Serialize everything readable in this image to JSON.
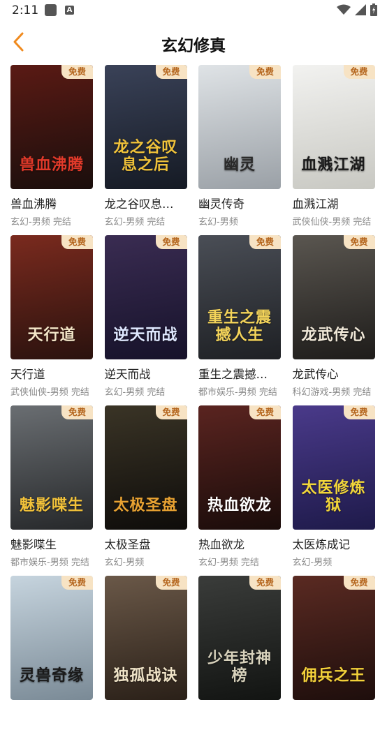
{
  "status_bar": {
    "time": "2:11",
    "a_icon_label": "A"
  },
  "header": {
    "title": "玄幻修真"
  },
  "badge_label": "免费",
  "books": [
    {
      "name": "兽血沸腾",
      "meta": "玄幻-男频 完结",
      "cover_title": "兽血沸腾",
      "bg": "#5a1a14",
      "bg2": "#1a0e0c",
      "fg": "#e23a2a"
    },
    {
      "name": "龙之谷叹息…",
      "meta": "玄幻-男频 完结",
      "cover_title": "龙之谷叹息之后",
      "bg": "#3a4258",
      "bg2": "#151a24",
      "fg": "#f0c23a"
    },
    {
      "name": "幽灵传奇",
      "meta": "玄幻-男频",
      "cover_title": "幽灵",
      "bg": "#dfe3e6",
      "bg2": "#9aa0a6",
      "fg": "#2a2a2a"
    },
    {
      "name": "血溅江湖",
      "meta": "武侠仙侠-男频 完结",
      "cover_title": "血溅江湖",
      "bg": "#f2f2f0",
      "bg2": "#c8c8c2",
      "fg": "#1a1a1a"
    },
    {
      "name": "天行道",
      "meta": "武侠仙侠-男频 完结",
      "cover_title": "天行道",
      "bg": "#7a2a1e",
      "bg2": "#2a120e",
      "fg": "#f4e6c8"
    },
    {
      "name": "逆天而战",
      "meta": "玄幻-男频 完结",
      "cover_title": "逆天而战",
      "bg": "#3a2c52",
      "bg2": "#16122a",
      "fg": "#dfe8ff"
    },
    {
      "name": "重生之震撼…",
      "meta": "都市娱乐-男频 完结",
      "cover_title": "重生之震撼人生",
      "bg": "#4a4e56",
      "bg2": "#1e2024",
      "fg": "#f4d45a"
    },
    {
      "name": "龙武传心",
      "meta": "科幻游戏-男频 完结",
      "cover_title": "龙武传心",
      "bg": "#5a5650",
      "bg2": "#1e1c1a",
      "fg": "#f0e8d8"
    },
    {
      "name": "魅影喋生",
      "meta": "都市娱乐-男频 完结",
      "cover_title": "魅影喋生",
      "bg": "#6a6e72",
      "bg2": "#26282a",
      "fg": "#f2c23a"
    },
    {
      "name": "太极圣盘",
      "meta": "玄幻-男频",
      "cover_title": "太极圣盘",
      "bg": "#3a3426",
      "bg2": "#0e0c0a",
      "fg": "#e8a232"
    },
    {
      "name": "热血欲龙",
      "meta": "玄幻-男频 完结",
      "cover_title": "热血欲龙",
      "bg": "#5a2420",
      "bg2": "#1a0c0a",
      "fg": "#ffffff"
    },
    {
      "name": "太医炼成记",
      "meta": "玄幻-男频",
      "cover_title": "太医修炼狱",
      "bg": "#4a3a8a",
      "bg2": "#1e1a4a",
      "fg": "#f2d63a"
    },
    {
      "name": "",
      "meta": "",
      "cover_title": "灵兽奇缘",
      "bg": "#c6d4de",
      "bg2": "#7a8a96",
      "fg": "#1a1a1a"
    },
    {
      "name": "",
      "meta": "",
      "cover_title": "独孤战诀",
      "bg": "#6a5848",
      "bg2": "#2a2018",
      "fg": "#f0e4c8"
    },
    {
      "name": "",
      "meta": "",
      "cover_title": "少年封神榜",
      "bg": "#3a3c3a",
      "bg2": "#121412",
      "fg": "#d8d2bc"
    },
    {
      "name": "",
      "meta": "",
      "cover_title": "佣兵之王",
      "bg": "#5a2a22",
      "bg2": "#1e0e0c",
      "fg": "#f4d23a"
    }
  ]
}
